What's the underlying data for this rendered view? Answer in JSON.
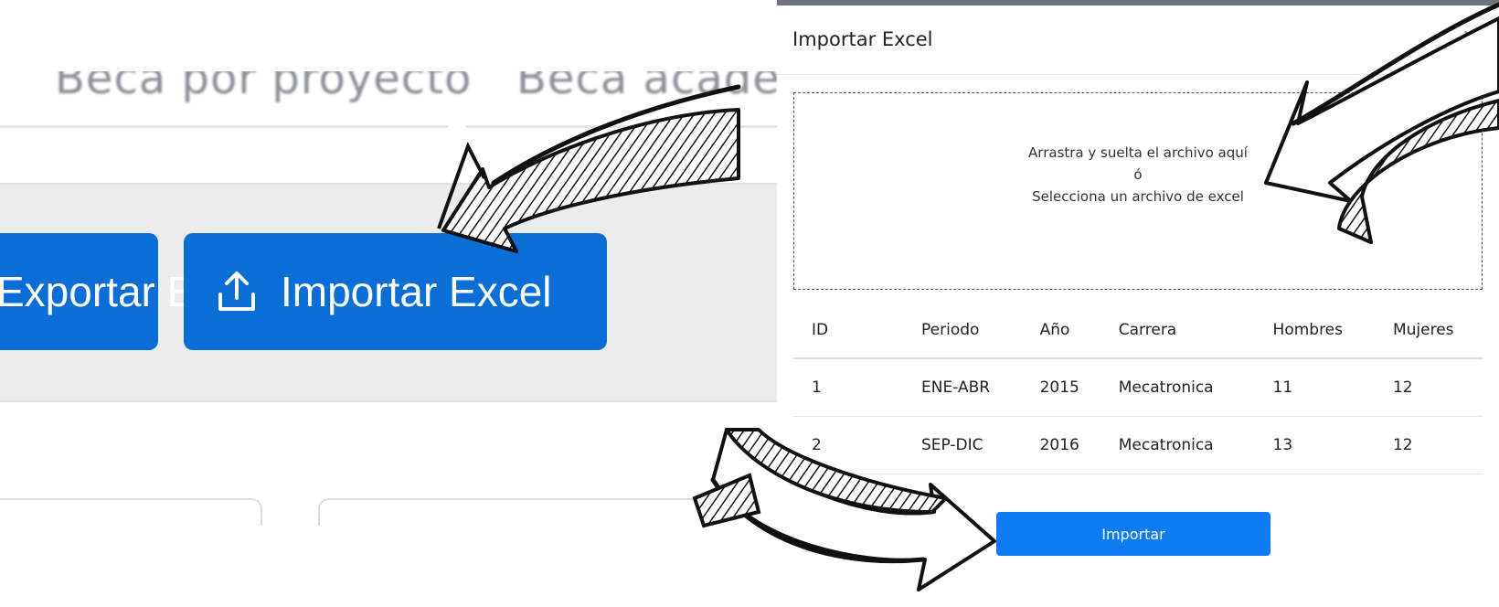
{
  "background": {
    "tabs": [
      "Beca por proyecto",
      "Beca académica"
    ],
    "export_button_label": "Exportar Excel",
    "import_button_label": "Importar Excel",
    "accent_color": "#0a6ed6"
  },
  "modal": {
    "title": "Importar Excel",
    "close_symbol": "×",
    "dropzone": {
      "line1": "Arrastra y suelta el archivo aquí",
      "line2": "ó",
      "line3": "Selecciona un archivo de excel"
    },
    "table": {
      "headers": [
        "ID",
        "Periodo",
        "Año",
        "Carrera",
        "Hombres",
        "Mujeres"
      ],
      "rows": [
        [
          "1",
          "ENE-ABR",
          "2015",
          "Mecatronica",
          "11",
          "12"
        ],
        [
          "2",
          "SEP-DIC",
          "2016",
          "Mecatronica",
          "13",
          "12"
        ]
      ]
    },
    "submit_label": "Importar",
    "submit_color": "#0d7cf2"
  },
  "icons": [
    "upload-icon",
    "close-icon",
    "hand-drawn-arrow-icon"
  ]
}
